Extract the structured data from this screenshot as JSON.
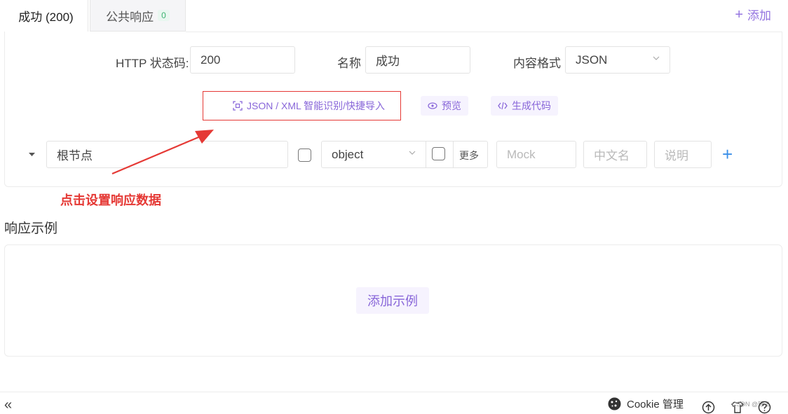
{
  "tabs": {
    "active_label": "成功 (200)",
    "inactive_label": "公共响应",
    "inactive_badge": "0",
    "add_label": "添加"
  },
  "form": {
    "status_code_label": "HTTP 状态码:",
    "status_code_value": "200",
    "name_label": "名称",
    "name_value": "成功",
    "content_format_label": "内容格式",
    "content_format_value": "JSON"
  },
  "actions": {
    "import_label": "JSON / XML 智能识别/快捷导入",
    "preview_label": "预览",
    "codegen_label": "生成代码"
  },
  "schema_row": {
    "node_name": "根节点",
    "type_value": "object",
    "more_label": "更多",
    "mock_placeholder": "Mock",
    "cn_name_placeholder": "中文名",
    "desc_placeholder": "说明"
  },
  "annotation": {
    "text": "点击设置响应数据"
  },
  "example": {
    "section_title": "响应示例",
    "add_example_label": "添加示例"
  },
  "footer": {
    "collapse_glyph": "«",
    "cookie_label": "Cookie 管理",
    "watermark": "CSDN @琢.£"
  },
  "colors": {
    "accent_purple": "#8866d9",
    "annotation_red": "#e53935",
    "plus_blue": "#3b8fe8",
    "badge_green": "#3cb371"
  }
}
